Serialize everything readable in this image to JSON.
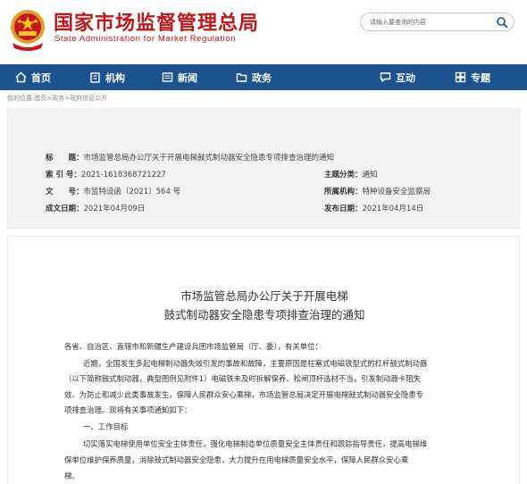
{
  "header": {
    "title_cn": "国家市场监督管理总局",
    "title_en": "State Administration for Market Regulation",
    "search_placeholder": "请输入要查询的内容",
    "brand_color": "#c0161b"
  },
  "nav": {
    "background": "#1b5390",
    "items": [
      {
        "label": "首页",
        "icon": "home-icon"
      },
      {
        "label": "机构",
        "icon": "building-icon"
      },
      {
        "label": "新闻",
        "icon": "news-icon"
      },
      {
        "label": "政务",
        "icon": "folder-icon"
      },
      {
        "label": "互动",
        "icon": "chat-icon"
      },
      {
        "label": "专题",
        "icon": "topic-icon"
      }
    ]
  },
  "breadcrumb": "你的位置:首页>政务>政府信息公开",
  "info": {
    "title_label": "标　　题：",
    "title_value": "市场监管总局办公厅关于开展电梯鼓式制动器安全隐患专项排查治理的通知",
    "index_label": "索 引 号：",
    "index_value": "2021-1618368721227",
    "category_label": "主题分类：",
    "category_value": "通知",
    "docno_label": "文　　号：",
    "docno_value": "市监特设函〔2021〕564 号",
    "dept_label": "所属机构：",
    "dept_value": "特种设备安全监察局",
    "created_label": "成文日期：",
    "created_value": "2021年04月09日",
    "published_label": "发布日期：",
    "published_value": "2021年04月14日"
  },
  "article": {
    "heading_line1": "市场监管总局办公厅关于开展电梯",
    "heading_line2": "鼓式制动器安全隐患专项排查治理的通知",
    "salutation": "各省、自治区、直辖市和新疆生产建设兵团市场监管局（厅、委），有关单位：",
    "para1_line1": "近期，全国发生多起电梯制动器失效引发的事故和故障，主要原因是柱塞式电磁铁型式的杠杆鼓式制动器",
    "para1_line2": "（以下简称鼓式制动器，典型图例见附件1）电磁铁未及时拆解保养、松闸顶杆选材不当，引发制动器卡阻失",
    "para1_line3": "效。为防止和减少此类事故发生，保障人民群众安心乘梯，市场监管总局决定开展电梯鼓式制动器安全隐患专",
    "para1_line4": "项排查治理。现将有关事项通知如下：",
    "section1": "一、工作目标",
    "para2_line1": "切实落实电梯使用单位安全主体责任，强化电梯制造单位质量安全主体责任和跟踪指导责任，提高电梯维",
    "para2_line2": "保单位维护保养质量，消除鼓式制动器安全隐患，大力提升在用电梯质量安全水平，保障人民群众安心乘",
    "para2_line3": "梯。"
  }
}
